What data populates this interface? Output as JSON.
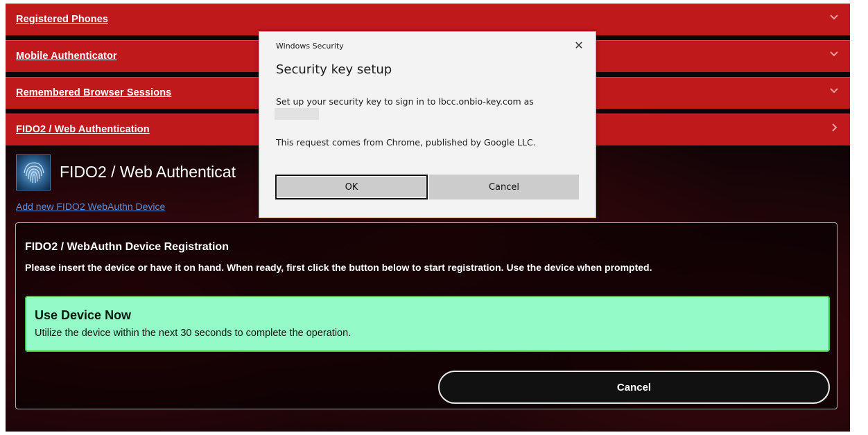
{
  "accordion": {
    "items": [
      {
        "label": "Registered Phones",
        "state": "collapsed"
      },
      {
        "label": "Mobile Authenticator",
        "state": "collapsed"
      },
      {
        "label": "Remembered Browser Sessions",
        "state": "collapsed"
      },
      {
        "label": "FIDO2 / Web Authentication",
        "state": "expanded"
      }
    ]
  },
  "section": {
    "title": "FIDO2 / Web Authenticat",
    "add_link": "Add new FIDO2 WebAuthn Device",
    "logo_icon": "fingerprint-icon"
  },
  "registration": {
    "title": "FIDO2 / WebAuthn Device Registration",
    "description": "Please insert the device or have it on hand. When ready, first click the button below to start registration. Use the device when prompted.",
    "alert_title": "Use Device Now",
    "alert_text": "Utilize the device within the next 30 seconds to complete the operation.",
    "cancel_label": "Cancel"
  },
  "dialog": {
    "caption": "Windows Security",
    "heading": "Security key setup",
    "message": "Set up your security key to sign in to lbcc.onbio-key.com as",
    "origin": "This request comes from Chrome, published by Google LLC.",
    "ok_label": "OK",
    "cancel_label": "Cancel",
    "close_glyph": "✕"
  },
  "colors": {
    "accordion_red": "#c0191c",
    "alert_green": "#94fac8",
    "alert_border": "#3fc43f",
    "link_blue": "#5b8fd6"
  }
}
